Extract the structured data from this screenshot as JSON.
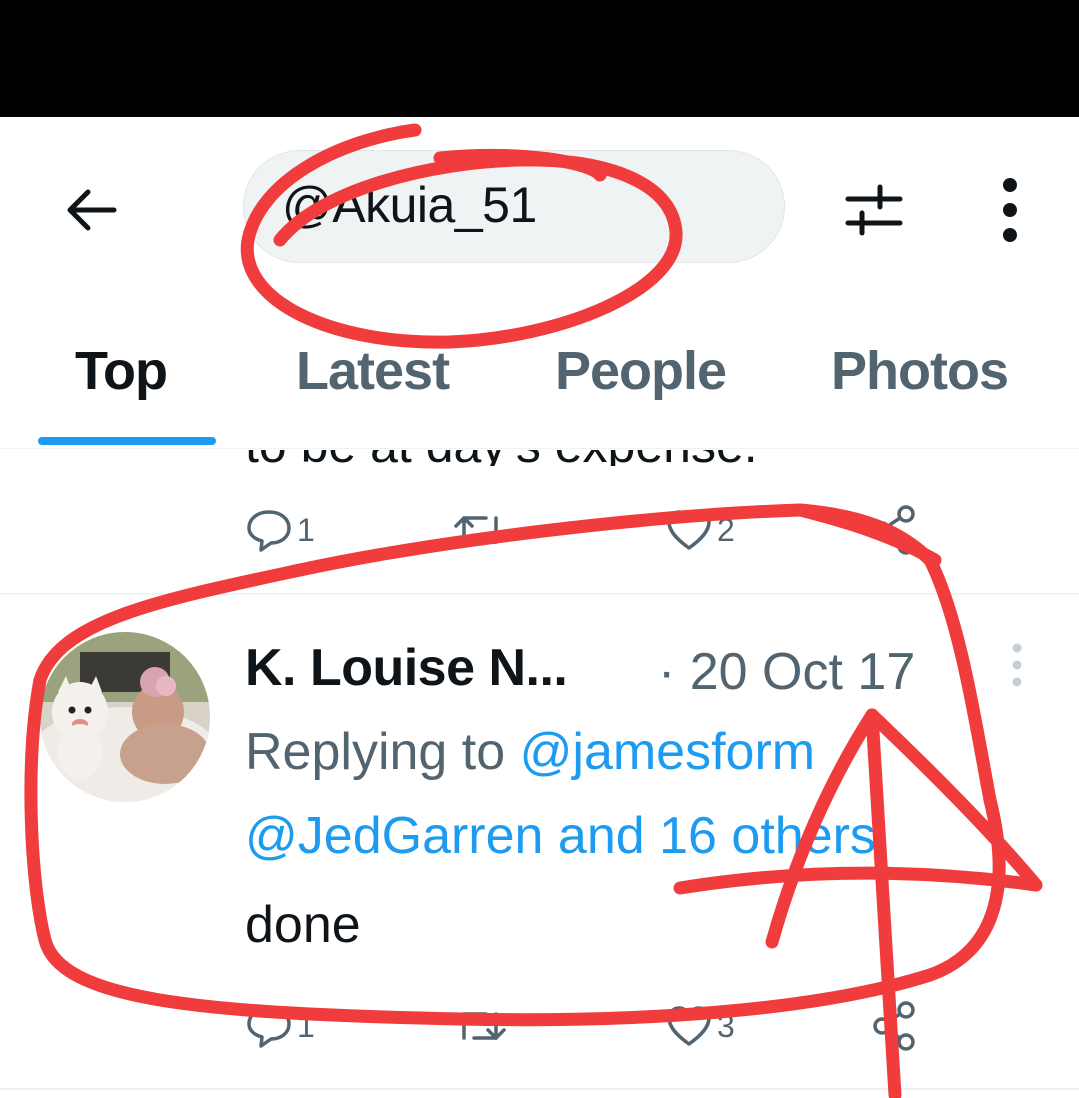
{
  "search": {
    "query": "@Akuia_51"
  },
  "tabs": [
    {
      "label": "Top",
      "active": true
    },
    {
      "label": "Latest",
      "active": false
    },
    {
      "label": "People",
      "active": false
    },
    {
      "label": "Photos",
      "active": false
    }
  ],
  "previous_tweet": {
    "cut_text": "to be at day's expense.",
    "reply_count": "1",
    "retweet_count": "",
    "like_count": "2"
  },
  "tweet": {
    "author": "K. Louise N...",
    "separator_date": "· 20 Oct 17",
    "replying_prefix": "Replying to ",
    "reply_handle_1": "@jamesform",
    "reply_handle_2": "@JedGarren",
    "reply_others": " and 16 others",
    "body": "done",
    "reply_count": "1",
    "retweet_count": "",
    "like_count": "3"
  },
  "colors": {
    "accent": "#1d9bf0",
    "secondary_text": "#536471",
    "annotation_red": "#f03c3c"
  },
  "icons": [
    "back-arrow-icon",
    "filter-sliders-icon",
    "more-vertical-icon",
    "reply-icon",
    "retweet-icon",
    "like-icon",
    "share-icon"
  ]
}
